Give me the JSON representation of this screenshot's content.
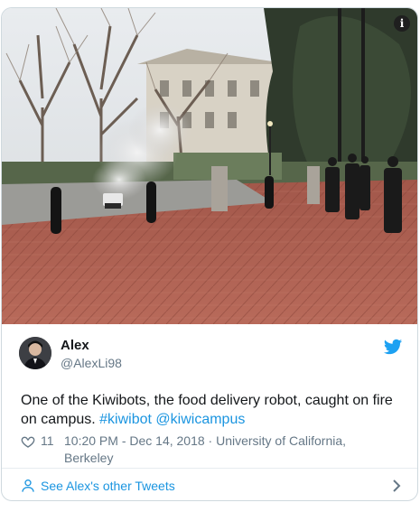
{
  "tweet": {
    "name": "Alex",
    "handle": "@AlexLi98",
    "text_main": "One of the Kiwibots, the food delivery robot, caught on fire on campus. ",
    "hashtags": [
      "#kiwibot",
      "@kiwicampus"
    ],
    "likes": "11",
    "timestamp_line": "10:20 PM - Dec 14, 2018 · University of California, Berkeley",
    "other_tweets_label": "See Alex's other Tweets"
  },
  "icons": {
    "info": "info-icon",
    "twitter": "twitter-bird-icon",
    "like": "heart-icon",
    "profile": "person-icon",
    "chevron": "chevron-right-icon"
  },
  "colors": {
    "link": "#1b95e0",
    "muted": "#657786",
    "border": "#cfd9de"
  }
}
